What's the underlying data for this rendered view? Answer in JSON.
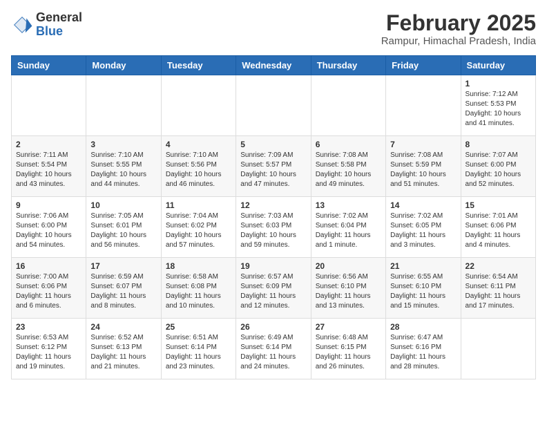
{
  "header": {
    "logo": {
      "line1": "General",
      "line2": "Blue"
    },
    "title": "February 2025",
    "subtitle": "Rampur, Himachal Pradesh, India"
  },
  "weekdays": [
    "Sunday",
    "Monday",
    "Tuesday",
    "Wednesday",
    "Thursday",
    "Friday",
    "Saturday"
  ],
  "weeks": [
    [
      {
        "day": "",
        "info": ""
      },
      {
        "day": "",
        "info": ""
      },
      {
        "day": "",
        "info": ""
      },
      {
        "day": "",
        "info": ""
      },
      {
        "day": "",
        "info": ""
      },
      {
        "day": "",
        "info": ""
      },
      {
        "day": "1",
        "info": "Sunrise: 7:12 AM\nSunset: 5:53 PM\nDaylight: 10 hours and 41 minutes."
      }
    ],
    [
      {
        "day": "2",
        "info": "Sunrise: 7:11 AM\nSunset: 5:54 PM\nDaylight: 10 hours and 43 minutes."
      },
      {
        "day": "3",
        "info": "Sunrise: 7:10 AM\nSunset: 5:55 PM\nDaylight: 10 hours and 44 minutes."
      },
      {
        "day": "4",
        "info": "Sunrise: 7:10 AM\nSunset: 5:56 PM\nDaylight: 10 hours and 46 minutes."
      },
      {
        "day": "5",
        "info": "Sunrise: 7:09 AM\nSunset: 5:57 PM\nDaylight: 10 hours and 47 minutes."
      },
      {
        "day": "6",
        "info": "Sunrise: 7:08 AM\nSunset: 5:58 PM\nDaylight: 10 hours and 49 minutes."
      },
      {
        "day": "7",
        "info": "Sunrise: 7:08 AM\nSunset: 5:59 PM\nDaylight: 10 hours and 51 minutes."
      },
      {
        "day": "8",
        "info": "Sunrise: 7:07 AM\nSunset: 6:00 PM\nDaylight: 10 hours and 52 minutes."
      }
    ],
    [
      {
        "day": "9",
        "info": "Sunrise: 7:06 AM\nSunset: 6:00 PM\nDaylight: 10 hours and 54 minutes."
      },
      {
        "day": "10",
        "info": "Sunrise: 7:05 AM\nSunset: 6:01 PM\nDaylight: 10 hours and 56 minutes."
      },
      {
        "day": "11",
        "info": "Sunrise: 7:04 AM\nSunset: 6:02 PM\nDaylight: 10 hours and 57 minutes."
      },
      {
        "day": "12",
        "info": "Sunrise: 7:03 AM\nSunset: 6:03 PM\nDaylight: 10 hours and 59 minutes."
      },
      {
        "day": "13",
        "info": "Sunrise: 7:02 AM\nSunset: 6:04 PM\nDaylight: 11 hours and 1 minute."
      },
      {
        "day": "14",
        "info": "Sunrise: 7:02 AM\nSunset: 6:05 PM\nDaylight: 11 hours and 3 minutes."
      },
      {
        "day": "15",
        "info": "Sunrise: 7:01 AM\nSunset: 6:06 PM\nDaylight: 11 hours and 4 minutes."
      }
    ],
    [
      {
        "day": "16",
        "info": "Sunrise: 7:00 AM\nSunset: 6:06 PM\nDaylight: 11 hours and 6 minutes."
      },
      {
        "day": "17",
        "info": "Sunrise: 6:59 AM\nSunset: 6:07 PM\nDaylight: 11 hours and 8 minutes."
      },
      {
        "day": "18",
        "info": "Sunrise: 6:58 AM\nSunset: 6:08 PM\nDaylight: 11 hours and 10 minutes."
      },
      {
        "day": "19",
        "info": "Sunrise: 6:57 AM\nSunset: 6:09 PM\nDaylight: 11 hours and 12 minutes."
      },
      {
        "day": "20",
        "info": "Sunrise: 6:56 AM\nSunset: 6:10 PM\nDaylight: 11 hours and 13 minutes."
      },
      {
        "day": "21",
        "info": "Sunrise: 6:55 AM\nSunset: 6:10 PM\nDaylight: 11 hours and 15 minutes."
      },
      {
        "day": "22",
        "info": "Sunrise: 6:54 AM\nSunset: 6:11 PM\nDaylight: 11 hours and 17 minutes."
      }
    ],
    [
      {
        "day": "23",
        "info": "Sunrise: 6:53 AM\nSunset: 6:12 PM\nDaylight: 11 hours and 19 minutes."
      },
      {
        "day": "24",
        "info": "Sunrise: 6:52 AM\nSunset: 6:13 PM\nDaylight: 11 hours and 21 minutes."
      },
      {
        "day": "25",
        "info": "Sunrise: 6:51 AM\nSunset: 6:14 PM\nDaylight: 11 hours and 23 minutes."
      },
      {
        "day": "26",
        "info": "Sunrise: 6:49 AM\nSunset: 6:14 PM\nDaylight: 11 hours and 24 minutes."
      },
      {
        "day": "27",
        "info": "Sunrise: 6:48 AM\nSunset: 6:15 PM\nDaylight: 11 hours and 26 minutes."
      },
      {
        "day": "28",
        "info": "Sunrise: 6:47 AM\nSunset: 6:16 PM\nDaylight: 11 hours and 28 minutes."
      },
      {
        "day": "",
        "info": ""
      }
    ]
  ]
}
